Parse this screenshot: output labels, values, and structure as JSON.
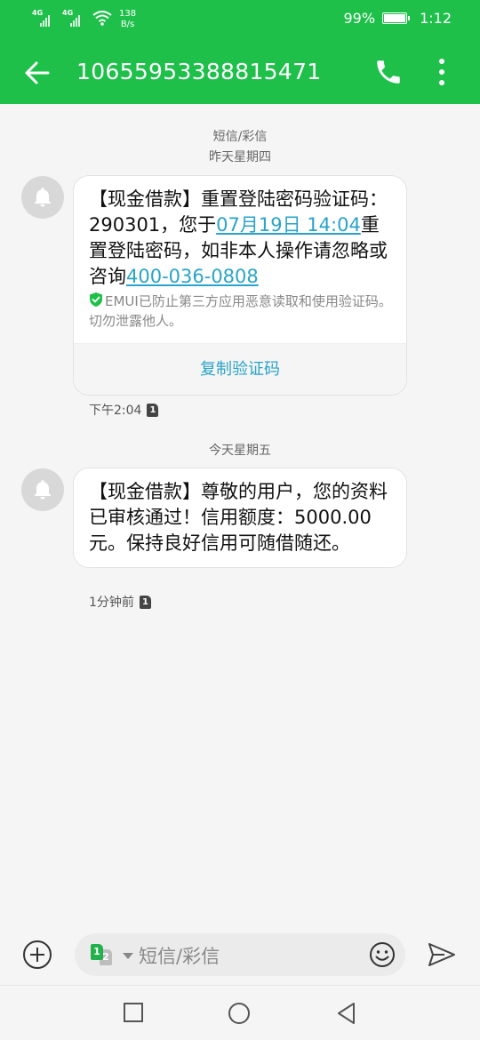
{
  "status_bar": {
    "signal1_label": "4G",
    "signal2_label": "4G",
    "speed_value": "138",
    "speed_unit": "B/s",
    "battery": "99%",
    "battery_level": 0.99,
    "time": "1:12"
  },
  "app_bar": {
    "title": "10655953388815471",
    "back_icon": "arrow-left-icon",
    "call_icon": "phone-icon",
    "more_icon": "more-vert-icon"
  },
  "thread": {
    "channel_label": "短信/彩信",
    "groups": [
      {
        "date": "昨天星期四",
        "message": {
          "text_before_date": "【现金借款】重置登陆密码验证码：290301，您于",
          "date_link": "07月19日 14:04",
          "text_after_date": "重置登陆密码，如非本人操作请忽略或咨询",
          "phone_link": "400-036-0808",
          "security_note": "EMUI已防止第三方应用恶意读取和使用验证码。切勿泄露他人。",
          "copy_button": "复制验证码",
          "time": "下午2:04",
          "sim": "1"
        }
      },
      {
        "date": "今天星期五",
        "message": {
          "text": "【现金借款】尊敬的用户，您的资料已审核通过！信用额度：5000.00元。保持良好信用可随借随还。",
          "time": "1分钟前",
          "sim": "1"
        }
      }
    ]
  },
  "input_bar": {
    "placeholder": "短信/彩信",
    "sim_primary": "1",
    "sim_secondary": "2"
  },
  "colors": {
    "brand_green": "#1ec04a",
    "link_blue": "#2aa3c8",
    "background": "#f5f5f5"
  }
}
